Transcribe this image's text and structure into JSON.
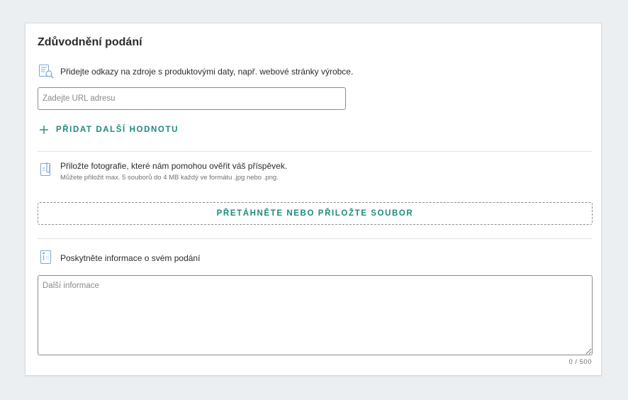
{
  "section": {
    "title": "Zdůvodnění podání"
  },
  "sources": {
    "icon": "search-document-icon",
    "instruction": "Přidejte odkazy na zdroje s produktovými daty, např. webové stránky výrobce.",
    "url_placeholder": "Zadejte URL adresu",
    "url_value": "",
    "add_label": "PŘIDAT DALŠÍ HODNOTU"
  },
  "photos": {
    "icon": "paperclip-document-icon",
    "instruction": "Přiložte fotografie, které nám pomohou ověřit váš příspěvek.",
    "hint": "Můžete přiložit max. 5 souborů do 4 MB každý ve formátu .jpg nebo .png.",
    "dropzone_label": "PŘETÁHNĚTE NEBO PŘILOŽTE SOUBOR"
  },
  "info": {
    "icon": "info-document-icon",
    "instruction": "Poskytněte informace o svém podání",
    "textarea_placeholder": "Další informace",
    "counter": "0  /  500"
  },
  "colors": {
    "accent": "#1f8a7c",
    "icon_blue": "#7aa7d9",
    "background": "#eceff2"
  }
}
